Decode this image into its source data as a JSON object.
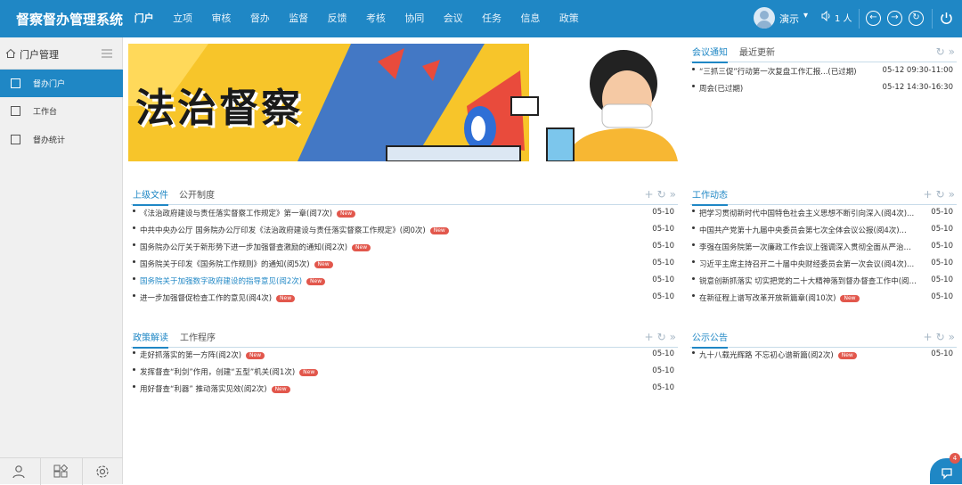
{
  "app": {
    "title": "督察督办管理系统"
  },
  "topnav": {
    "items": [
      {
        "label": "门户",
        "active": true
      },
      {
        "label": "立项"
      },
      {
        "label": "审核"
      },
      {
        "label": "督办"
      },
      {
        "label": "监督"
      },
      {
        "label": "反馈"
      },
      {
        "label": "考核"
      },
      {
        "label": "协同"
      },
      {
        "label": "会议"
      },
      {
        "label": "任务"
      },
      {
        "label": "信息"
      },
      {
        "label": "政策"
      }
    ]
  },
  "user": {
    "name": "演示",
    "online_count": "1 人"
  },
  "sidebar": {
    "header": "门户管理",
    "items": [
      {
        "label": "督办门户",
        "active": true
      },
      {
        "label": "工作台"
      },
      {
        "label": "督办统计"
      }
    ]
  },
  "banner": {
    "title": "法治督察"
  },
  "meeting_panel": {
    "tabs": [
      "会议通知",
      "最近更新"
    ],
    "rows": [
      {
        "text": "“三抓三促”行动第一次复盘工作汇报...(已过期)",
        "date": "05-12 09:30-11:00"
      },
      {
        "text": "周会(已过期)",
        "date": "05-12 14:30-16:30"
      }
    ]
  },
  "superior_panel": {
    "tabs": [
      "上级文件",
      "公开制度"
    ],
    "rows": [
      {
        "text": "《法治政府建设与责任落实督察工作规定》第一章(阅7次)",
        "new": "New",
        "date": "05-10"
      },
      {
        "text": "中共中央办公厅 国务院办公厅印发《法治政府建设与责任落实督察工作规定》(阅0次)",
        "new": "New",
        "date": "05-10"
      },
      {
        "text": "国务院办公厅关于新形势下进一步加强督查激励的通知(阅2次)",
        "new": "New",
        "date": "05-10"
      },
      {
        "text": "国务院关于印发《国务院工作规则》的通知(阅5次)",
        "new": "New",
        "date": "05-10"
      },
      {
        "text": "国务院关于加强数字政府建设的指导意见(阅2次)",
        "new": "New",
        "date": "05-10",
        "link": true
      },
      {
        "text": "进一步加强督促检查工作的意见(阅4次)",
        "new": "New",
        "date": "05-10"
      }
    ]
  },
  "work_panel": {
    "tabs": [
      "工作动态"
    ],
    "rows": [
      {
        "text": "把学习贯彻新时代中国特色社会主义思想不断引向深入(阅4次)...",
        "date": "05-10"
      },
      {
        "text": "中国共产党第十九届中央委员会第七次全体会议公报(阅4次)...",
        "date": "05-10"
      },
      {
        "text": "李强在国务院第一次廉政工作会议上强调深入贯彻全面从严治党...",
        "date": "05-10"
      },
      {
        "text": "习近平主席主持召开二十届中央财经委员会第一次会议(阅4次)...",
        "date": "05-10"
      },
      {
        "text": "锐意创新抓落实 切实把党的二十大精神落到督办督查工作中(阅3...",
        "date": "05-10"
      },
      {
        "text": "在新征程上谱写改革开放新篇章(阅10次)",
        "new": "New",
        "date": "05-10"
      }
    ]
  },
  "policy_panel": {
    "tabs": [
      "政策解读",
      "工作程序"
    ],
    "rows": [
      {
        "text": "走好抓落实的第一方阵(阅2次)",
        "new": "New",
        "date": "05-10"
      },
      {
        "text": "发挥督查“利剑”作用，创建“五型”机关(阅1次)",
        "new": "New",
        "date": "05-10"
      },
      {
        "text": "用好督查“利器” 推动落实见效(阅2次)",
        "new": "New",
        "date": "05-10"
      }
    ]
  },
  "notice_panel": {
    "tabs": [
      "公示公告"
    ],
    "rows": [
      {
        "text": "九十八载光辉路 不忘初心谱新篇(阅2次)",
        "new": "New",
        "date": "05-10"
      }
    ]
  },
  "float": {
    "badge": "4"
  },
  "colors": {
    "primary": "#1f87c5",
    "badge": "#e2574c",
    "banner": "#f7c52a"
  }
}
